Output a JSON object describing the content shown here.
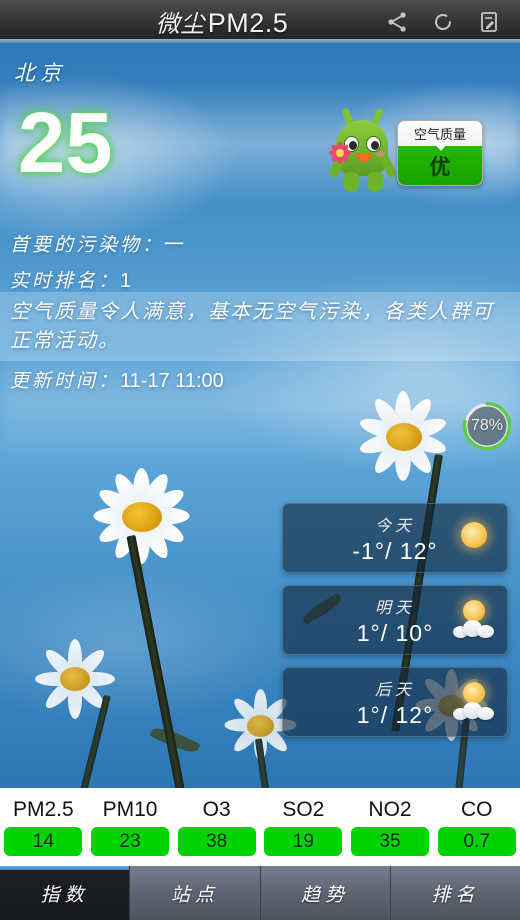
{
  "titlebar": {
    "title_cn": "微尘",
    "title_en": "PM2.5",
    "icons": [
      "share-icon",
      "refresh-icon",
      "note-icon"
    ]
  },
  "aqi": {
    "city": "北京",
    "value": "25",
    "value_color": "#ffffff",
    "glow_color": "#44cc44"
  },
  "badge": {
    "caption": "空气质量",
    "level": "优",
    "level_color": "#17a000"
  },
  "info": {
    "primary_pollutant_label": "首要的污染物：",
    "primary_pollutant_value": "一",
    "rank_label": "实时排名：",
    "rank_value": "1",
    "description": "空气质量令人满意，基本无空气污染，各类人群可正常活动。",
    "update_label": "更新时间：",
    "update_value": "11-17 11:00"
  },
  "humidity": {
    "value": "78%",
    "percent": 78,
    "arc_color": "#5ecb4c"
  },
  "forecast": [
    {
      "day": "今天",
      "temp": "-1°/ 12°",
      "icon": "sun-icon"
    },
    {
      "day": "明天",
      "temp": "1°/ 10°",
      "icon": "sun-cloud-icon"
    },
    {
      "day": "后天",
      "temp": "1°/ 12°",
      "icon": "sun-cloud-icon"
    }
  ],
  "pollutants": [
    {
      "name": "PM2.5",
      "value": "14",
      "color": "#00d400"
    },
    {
      "name": "PM10",
      "value": "23",
      "color": "#00d400"
    },
    {
      "name": "O3",
      "value": "38",
      "color": "#00d400"
    },
    {
      "name": "SO2",
      "value": "19",
      "color": "#00d400"
    },
    {
      "name": "NO2",
      "value": "35",
      "color": "#00d400"
    },
    {
      "name": "CO",
      "value": "0.7",
      "color": "#00d400"
    }
  ],
  "tabs": [
    {
      "label": "指数",
      "active": true
    },
    {
      "label": "站点",
      "active": false
    },
    {
      "label": "趋势",
      "active": false
    },
    {
      "label": "排名",
      "active": false
    }
  ]
}
